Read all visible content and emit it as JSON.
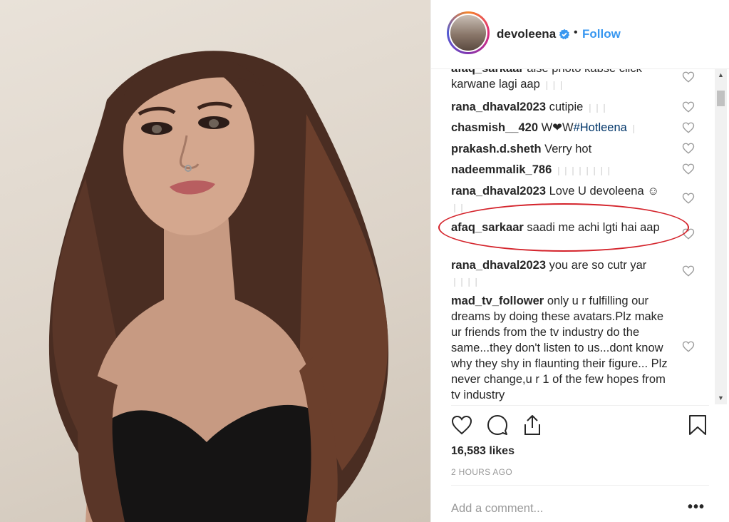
{
  "post": {
    "username": "devoleena",
    "separator": "•",
    "follow_label": "Follow",
    "likes": "16,583 likes",
    "time": "2 HOURS AGO",
    "add_comment_placeholder": "Add a comment...",
    "more_label": "•••"
  },
  "icons": {
    "verified": "verified-badge-icon",
    "comment_like": "heart-outline-icon",
    "like": "heart-icon",
    "comment": "speech-bubble-icon",
    "share": "share-icon",
    "save": "bookmark-icon"
  },
  "colors": {
    "accent": "#3897f0",
    "annotation": "#d4232b",
    "text": "#262626",
    "muted": "#999999"
  },
  "comments": [
    {
      "user": "afaq_sarkaar",
      "text": "aise photo kabse click karwane lagi aap",
      "tail": "❘❘❘"
    },
    {
      "user": "rana_dhaval2023",
      "text": "cutipie",
      "tail": "❘❘❘"
    },
    {
      "user": "chasmish__420",
      "text": "W❤W",
      "tag": "#Hotleena",
      "tail": "❘"
    },
    {
      "user": "prakash.d.sheth",
      "text": "Verry hot",
      "tail": ""
    },
    {
      "user": "nadeemmalik_786",
      "text": "",
      "tail": "❘❘❘❘❘❘❘❘"
    },
    {
      "user": "rana_dhaval2023",
      "text": "Love U devoleena ☺",
      "tail": "❘❘"
    },
    {
      "user": "afaq_sarkaar",
      "text": "saadi me achi lgti hai aap",
      "tail": ""
    },
    {
      "user": "rana_dhaval2023",
      "text": "you are so cutr yar",
      "tail": "❘❘❘❘"
    },
    {
      "user": "mad_tv_follower",
      "text": "only u r fulfilling our dreams by doing these avatars.Plz make ur friends from the tv industry do the same...they don't listen to us...dont know why they shy in flaunting their figure... Plz never change,u r 1 of the few hopes from tv industry",
      "tail": ""
    }
  ],
  "scrollbar": {
    "up": "▲",
    "down": "▼"
  }
}
